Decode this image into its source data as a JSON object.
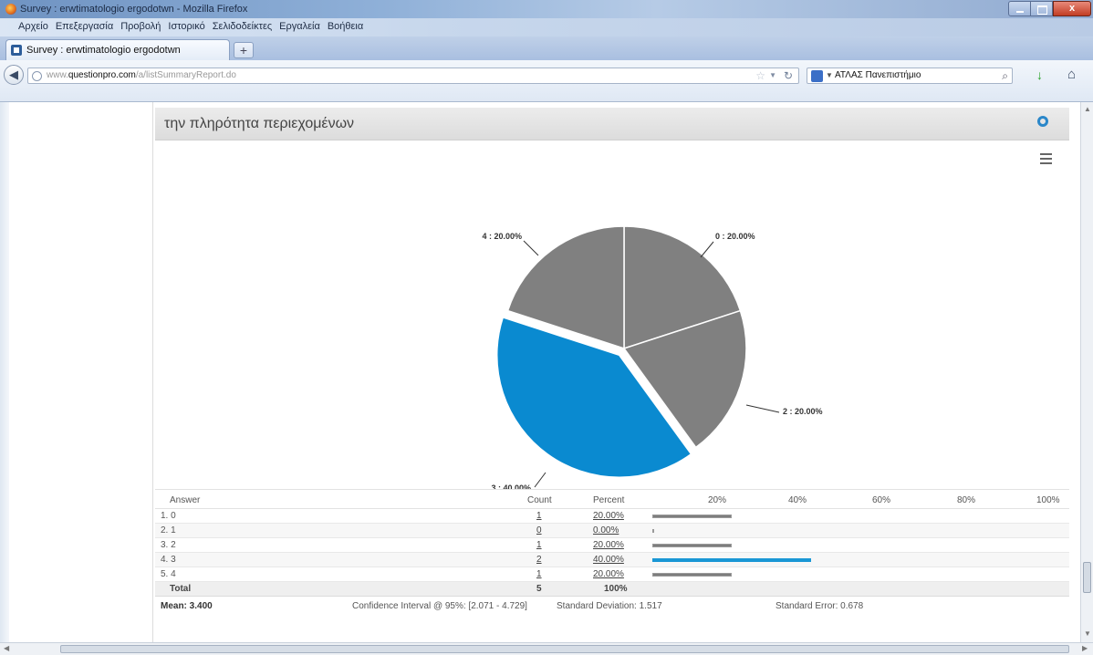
{
  "window": {
    "title": "Survey : erwtimatologio ergodotwn - Mozilla Firefox",
    "close_glyph": "x"
  },
  "menu": [
    "Αρχείο",
    "Επεξεργασία",
    "Προβολή",
    "Ιστορικό",
    "Σελιδοδείκτες",
    "Εργαλεία",
    "Βοήθεια"
  ],
  "tabs": [
    {
      "label": "Survey : erwtimatologio ergodotwn"
    }
  ],
  "new_tab_glyph": "+",
  "nav": {
    "url_prefix": "www.",
    "url_domain": "questionpro.com",
    "url_path": "/a/listSummaryReport.do",
    "search_query": "ΑΤΛΑΣ Πανεπιστήμιο"
  },
  "panel": {
    "title": "την πληρότητα περιεχομένων"
  },
  "chart_data": {
    "type": "pie",
    "slices": [
      {
        "label": "0 : 20.00%",
        "value": 20,
        "color": "#808080"
      },
      {
        "label": "2 : 20.00%",
        "value": 20,
        "color": "#808080"
      },
      {
        "label": "3 : 40.00%",
        "value": 40,
        "color": "#0a8ad0",
        "exploded": true
      },
      {
        "label": "4 : 20.00%",
        "value": 20,
        "color": "#808080"
      }
    ],
    "title": "",
    "legend": "none"
  },
  "table": {
    "headers": {
      "answer": "Answer",
      "count": "Count",
      "percent": "Percent"
    },
    "scale": [
      "20%",
      "40%",
      "60%",
      "80%",
      "100%"
    ],
    "rows": [
      {
        "answer": "1. 0",
        "count": "1",
        "percent": "20.00%",
        "fraction": 0.2,
        "highlight": false
      },
      {
        "answer": "2. 1",
        "count": "0",
        "percent": "0.00%",
        "fraction": 0.0,
        "highlight": false
      },
      {
        "answer": "3. 2",
        "count": "1",
        "percent": "20.00%",
        "fraction": 0.2,
        "highlight": false
      },
      {
        "answer": "4. 3",
        "count": "2",
        "percent": "40.00%",
        "fraction": 0.4,
        "highlight": true
      },
      {
        "answer": "5. 4",
        "count": "1",
        "percent": "20.00%",
        "fraction": 0.2,
        "highlight": false
      }
    ],
    "total": {
      "label": "Total",
      "count": "5",
      "percent": "100%"
    },
    "stats": {
      "mean": "Mean: 3.400",
      "confidence": "Confidence Interval @ 95%: [2.071 - 4.729]",
      "std_dev": "Standard Deviation: 1.517",
      "std_err": "Standard Error: 0.678"
    }
  }
}
